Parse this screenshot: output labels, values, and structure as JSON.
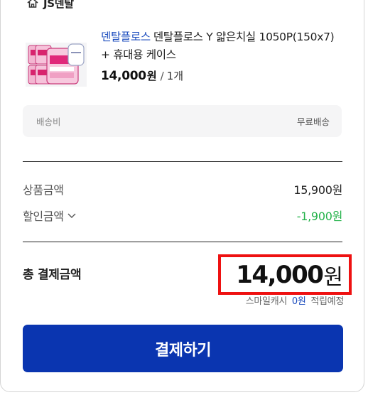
{
  "seller": {
    "icon": "home-icon",
    "name": "JS덴탈"
  },
  "product": {
    "brand": "덴탈플로스",
    "name": "덴탈플로스 Y 얇은치실 1050P(150x7) + 휴대용 케이스",
    "price": "14,000",
    "price_unit": "원",
    "separator": "/",
    "quantity": "1개",
    "thumbnail_icon": "floss-product-image"
  },
  "shipping": {
    "label": "배송비",
    "value": "무료배송"
  },
  "summary": {
    "goods_label": "상품금액",
    "goods_value": "15,900원",
    "discount_label": "할인금액",
    "discount_icon": "chevron-down-icon",
    "discount_value": "-1,900원"
  },
  "total": {
    "label": "총 결제금액",
    "value": "14,000",
    "unit": "원",
    "highlight_color": "#ee1111"
  },
  "cash": {
    "prefix": "스마일캐시",
    "amount": "0원",
    "suffix": "적립예정"
  },
  "pay_button": {
    "label": "결제하기",
    "color": "#0a35b0"
  },
  "colors": {
    "brand_link": "#1f4fbf",
    "discount": "#24b24a"
  }
}
